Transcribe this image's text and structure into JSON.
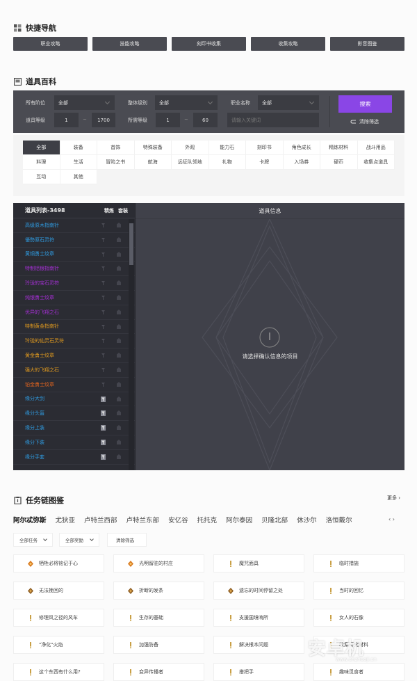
{
  "quick_nav": {
    "title": "快捷导航",
    "icon": "grid-icon",
    "buttons": [
      "职业攻略",
      "技能攻略",
      "刻印书收集",
      "收集攻略",
      "影音图鉴"
    ]
  },
  "item_wiki": {
    "title": "道具百科",
    "icon": "book-icon",
    "filters": {
      "tier_label": "所有阶位",
      "tier_value": "全部",
      "grade_label": "整体级别",
      "grade_value": "全部",
      "class_label": "职业名称",
      "class_value": "全部",
      "item_level_label": "道具等级",
      "item_level_min": "1",
      "item_level_max": "1700",
      "req_level_label": "所需等级",
      "req_level_min": "1",
      "req_level_max": "60",
      "keyword_placeholder": "请输入关键词",
      "range_sep": "~",
      "search_label": "搜索",
      "clear_label": "清除筛选"
    },
    "categories": [
      "全部",
      "装备",
      "首饰",
      "特殊装备",
      "外观",
      "能力石",
      "刻印书",
      "角色成长",
      "精炼材料",
      "战斗用品",
      "料理",
      "生活",
      "冒险之书",
      "航海",
      "远征队领地",
      "礼物",
      "卡牌",
      "入场券",
      "硬币",
      "收集点道具",
      "互动",
      "其他"
    ],
    "active_category": "全部",
    "list": {
      "title": "道具列表-3498",
      "col_refine": "精炼",
      "col_set": "套装",
      "items": [
        {
          "name": "高级原木指南针",
          "color": "#2f9be0",
          "refine": false
        },
        {
          "name": "優勢原石灵符",
          "color": "#2f9be0",
          "refine": false
        },
        {
          "name": "黄铜勇士纹章",
          "color": "#2f9be0",
          "refine": false
        },
        {
          "name": "特制铝银指南针",
          "color": "#a62fd6",
          "refine": false
        },
        {
          "name": "玲珑的宝石灵符",
          "color": "#a62fd6",
          "refine": false
        },
        {
          "name": "纯银勇士纹章",
          "color": "#a62fd6",
          "refine": false
        },
        {
          "name": "优异的飞翔之石",
          "color": "#a62fd6",
          "refine": false
        },
        {
          "name": "特制黄金指南针",
          "color": "#e09a1f",
          "refine": false
        },
        {
          "name": "玲珑的仙灵石灵符",
          "color": "#e09a1f",
          "refine": false
        },
        {
          "name": "黄金勇士纹章",
          "color": "#e09a1f",
          "refine": false
        },
        {
          "name": "强大的飞翔之石",
          "color": "#e09a1f",
          "refine": false
        },
        {
          "name": "铂金勇士纹章",
          "color": "#e0631f",
          "refine": false
        },
        {
          "name": "缘分大剑",
          "color": "#2f9be0",
          "refine": true
        },
        {
          "name": "缘分头盔",
          "color": "#2f9be0",
          "refine": true
        },
        {
          "name": "缘分上装",
          "color": "#2f9be0",
          "refine": true
        },
        {
          "name": "缘分下装",
          "color": "#2f9be0",
          "refine": true
        },
        {
          "name": "缘分手套",
          "color": "#2f9be0",
          "refine": true
        }
      ]
    },
    "info": {
      "title": "道具信息",
      "empty_text": "请选择确认信息的项目"
    }
  },
  "quest": {
    "title": "任务链图鉴",
    "icon": "scroll-icon",
    "more": "更多",
    "regions": [
      "阿尔忒弥斯",
      "尤狄亚",
      "卢特兰西部",
      "卢特兰东部",
      "安亿谷",
      "托托克",
      "阿尔泰因",
      "贝隆北部",
      "休沙尔",
      "洛恒戴尔"
    ],
    "active_region": "阿尔忒弥斯",
    "filter_task": "全部任务",
    "filter_reward": "全部奖励",
    "filter_clear": "清除筛选",
    "cards": [
      {
        "name": "牺牲必将铭记于心",
        "type": "main"
      },
      {
        "name": "光明留驻的村庄",
        "type": "main"
      },
      {
        "name": "魔咒面具",
        "type": "side"
      },
      {
        "name": "临时措施",
        "type": "side"
      },
      {
        "name": "无法挽回的",
        "type": "story"
      },
      {
        "name": "折断的发条",
        "type": "story"
      },
      {
        "name": "遗忘的时间停留之处",
        "type": "story"
      },
      {
        "name": "当时的回忆",
        "type": "side"
      },
      {
        "name": "修理风之径的风车",
        "type": "side"
      },
      {
        "name": "生存的基础",
        "type": "side"
      },
      {
        "name": "支援国境哨所",
        "type": "side"
      },
      {
        "name": "女人的石像",
        "type": "side"
      },
      {
        "name": "\"净化\"火焰",
        "type": "side"
      },
      {
        "name": "加强防备",
        "type": "side"
      },
      {
        "name": "解决根本问题",
        "type": "side"
      },
      {
        "name": "收集研究材料",
        "type": "side"
      },
      {
        "name": "这个东西有什么用?",
        "type": "side"
      },
      {
        "name": "变异传播者",
        "type": "side"
      },
      {
        "name": "搭把手",
        "type": "side"
      },
      {
        "name": "趣味觅食者",
        "type": "side"
      }
    ]
  },
  "watermark": {
    "text": "安卓机",
    "url": "www.anzhuoji.cn"
  }
}
